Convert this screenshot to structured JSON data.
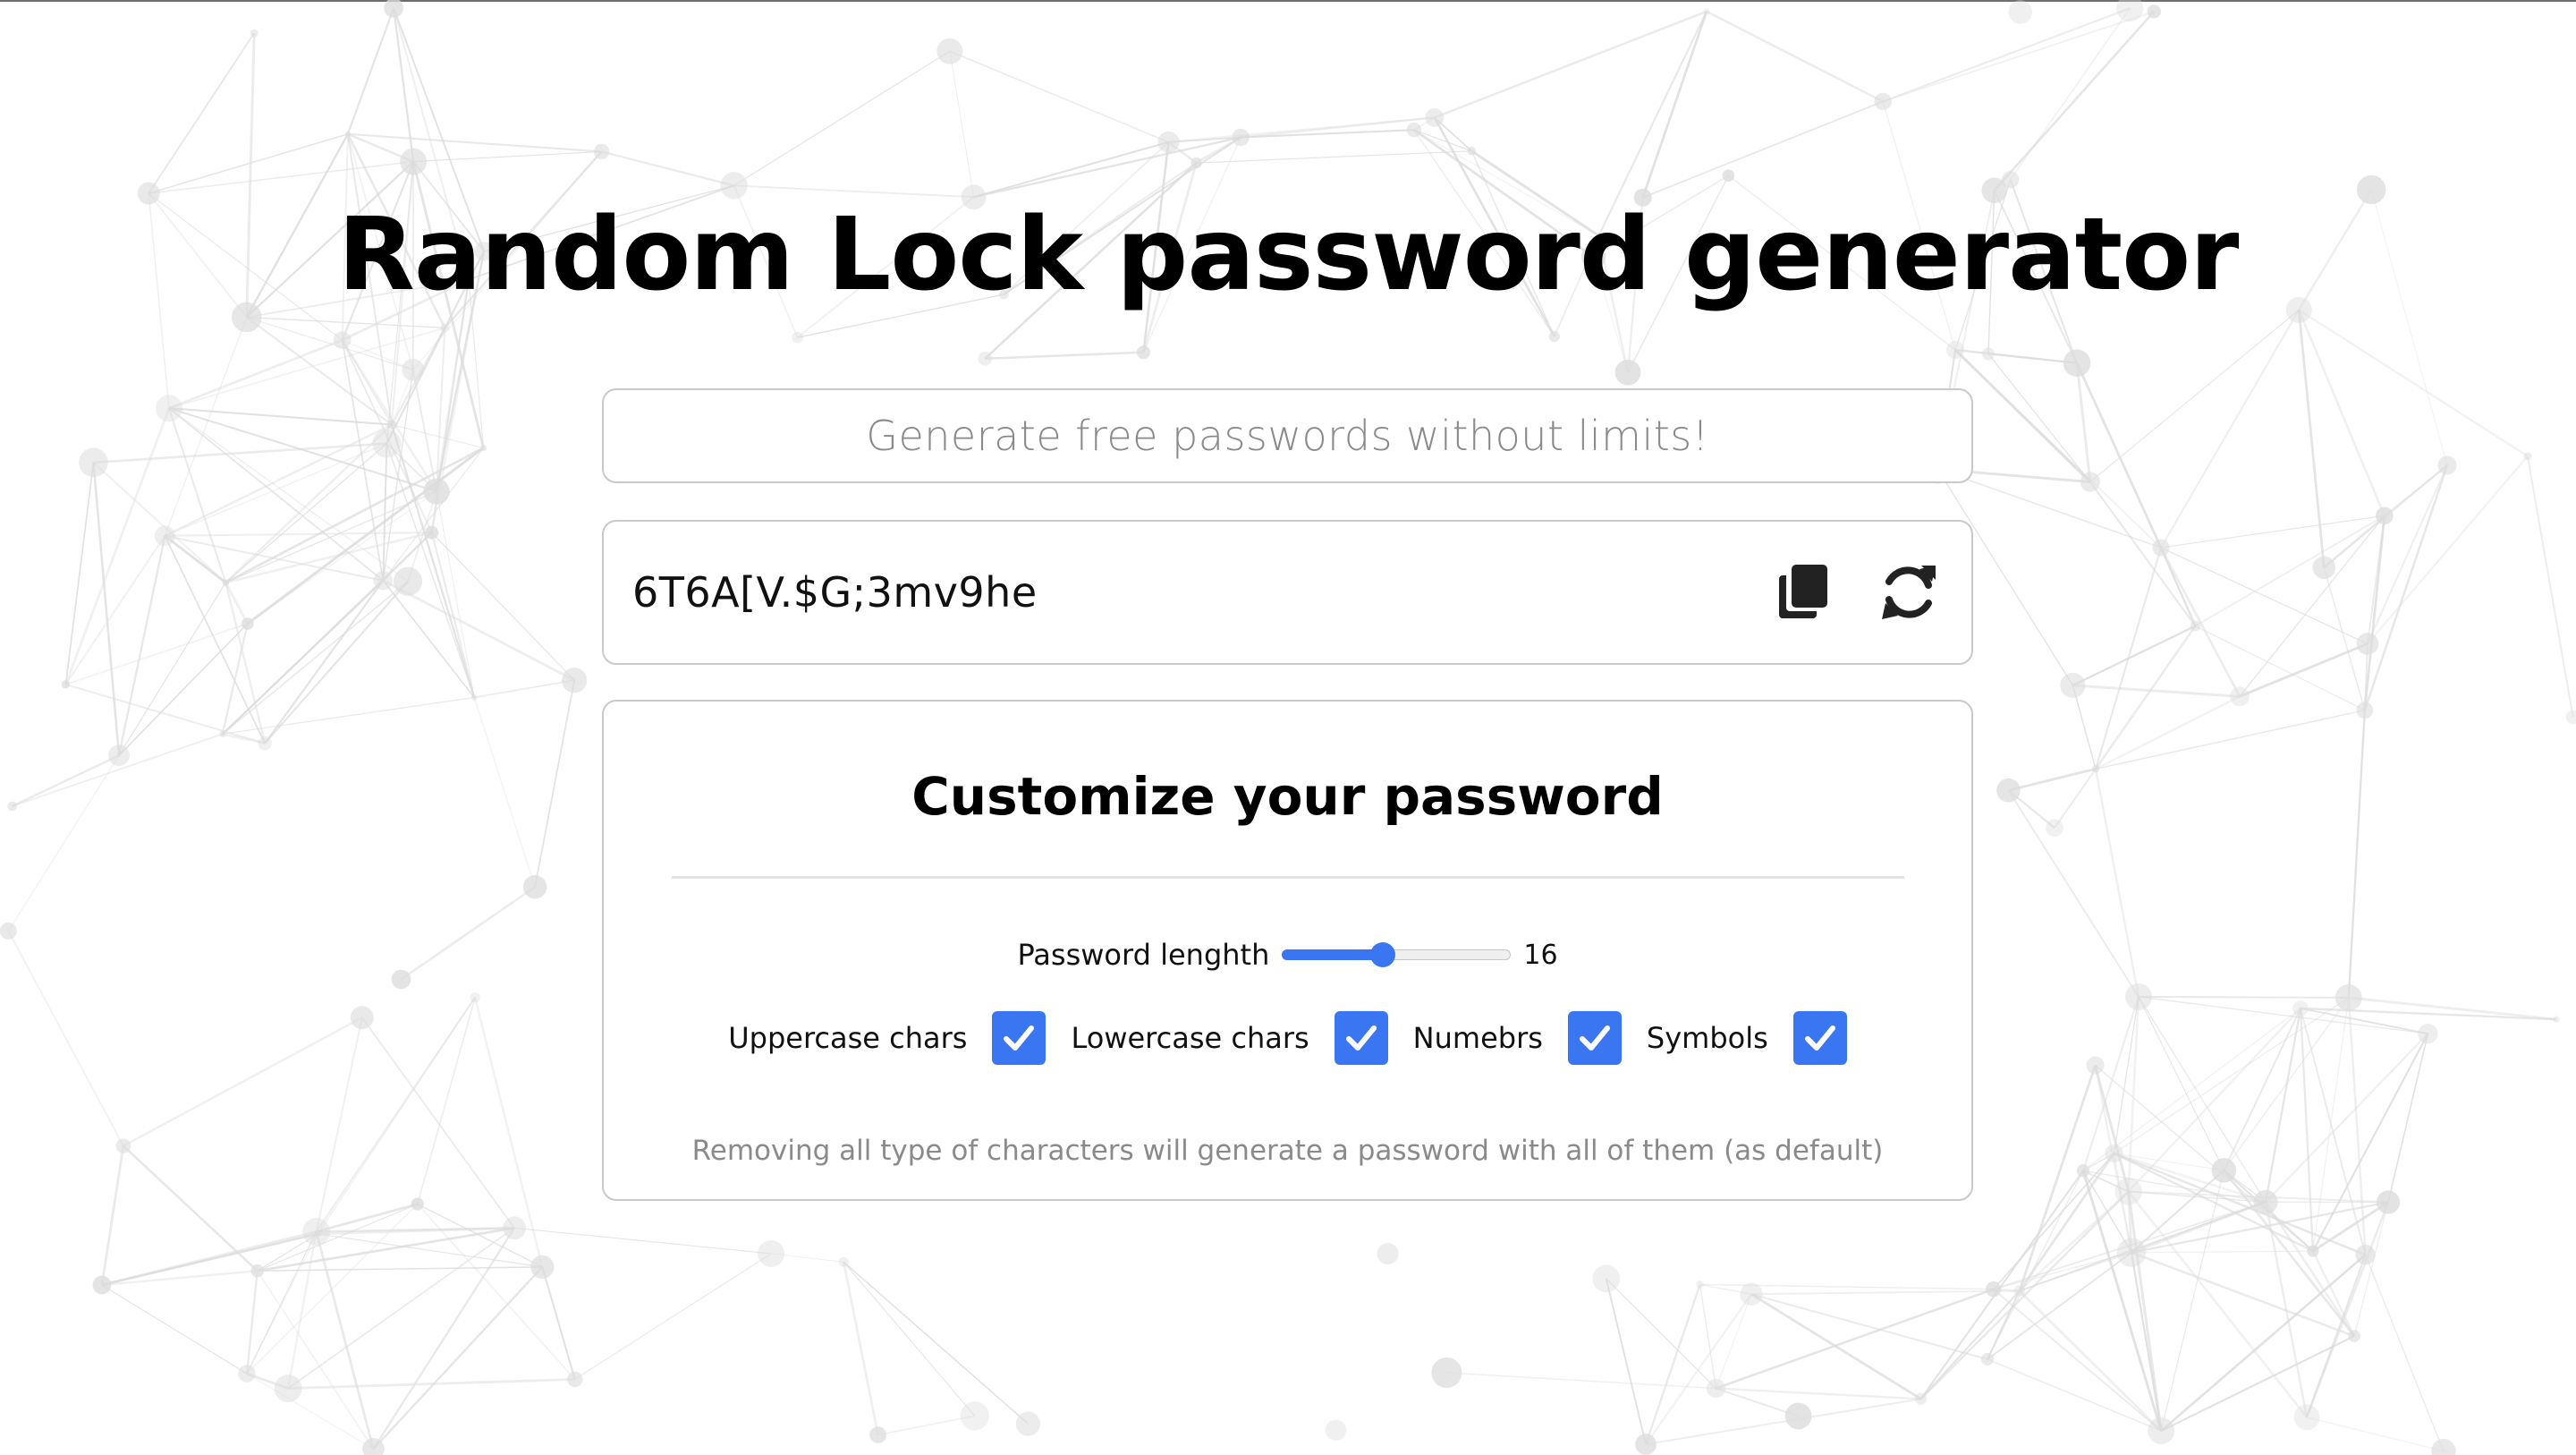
{
  "page": {
    "title": "Random Lock password generator"
  },
  "tagline": {
    "text": "Generate free passwords without limits!"
  },
  "password": {
    "value": "6T6A[V.$G;3mv9he",
    "copy_icon": "copy-icon",
    "refresh_icon": "refresh-icon"
  },
  "customize": {
    "title": "Customize your password",
    "length": {
      "label": "Password lenghth",
      "value": "16",
      "fill_fraction": 0.44
    },
    "options": [
      {
        "label": "Uppercase chars",
        "checked": true
      },
      {
        "label": "Lowercase chars",
        "checked": true
      },
      {
        "label": "Numebrs",
        "checked": true
      },
      {
        "label": "Symbols",
        "checked": true
      }
    ],
    "footnote": "Removing all type of characters will generate a password with all of them (as default)"
  },
  "colors": {
    "accent": "#3b76f2",
    "border": "#c9c9c9",
    "muted_text": "#8a8a8a",
    "background_network": "#dcdcdc"
  }
}
